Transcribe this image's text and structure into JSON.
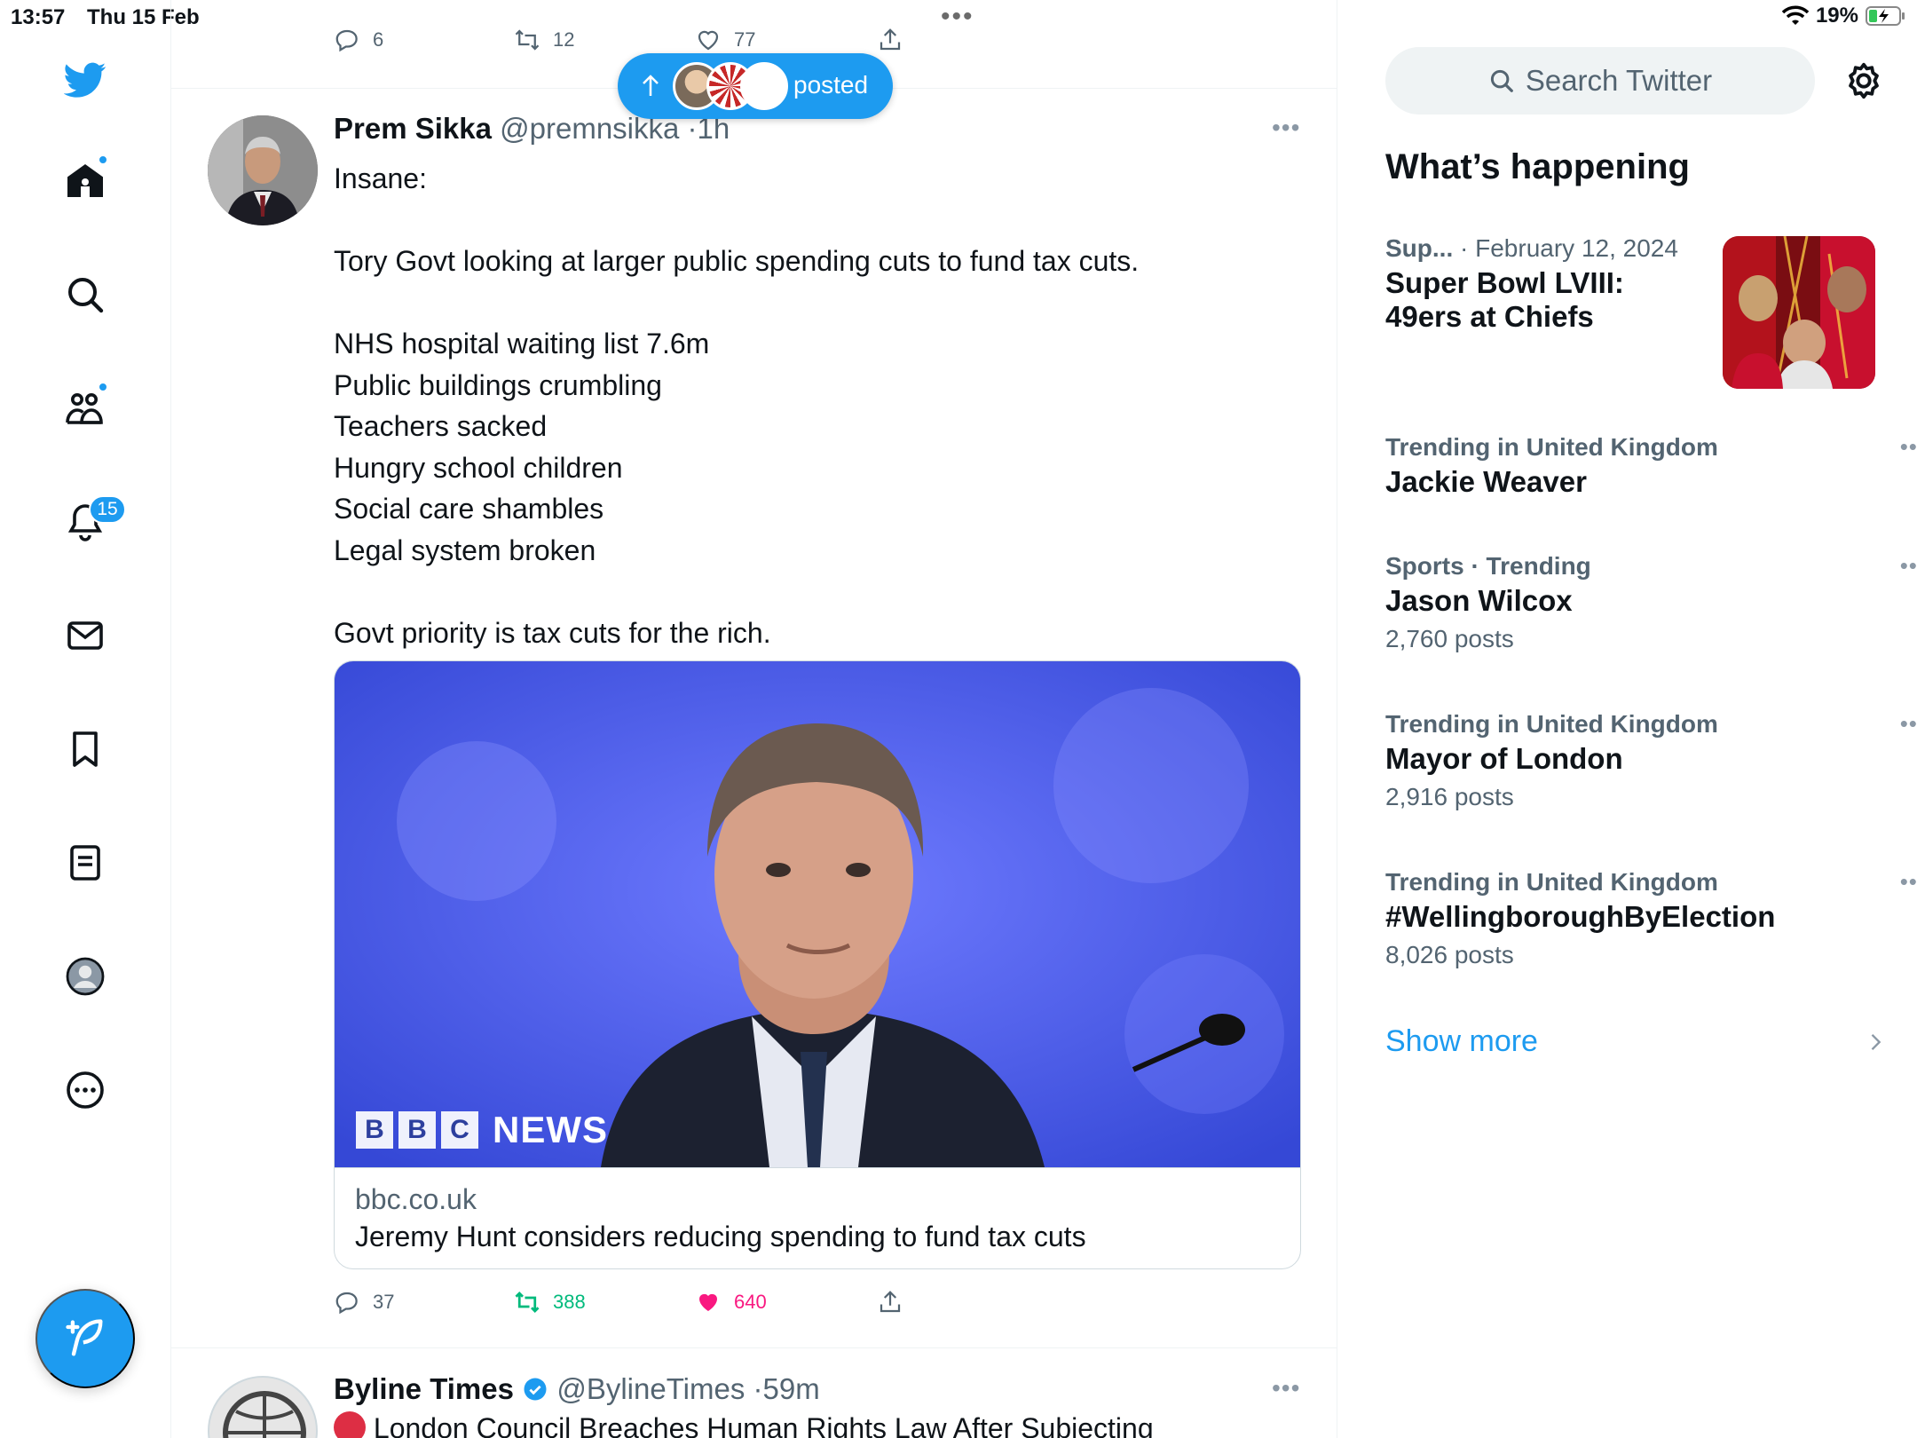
{
  "status_bar": {
    "time": "13:57",
    "date": "Thu 15 Feb",
    "battery": "19%"
  },
  "sidebar": {
    "notification_count": "15",
    "items": [
      "twitter-logo",
      "home-icon",
      "search-icon",
      "communities-icon",
      "notifications-icon",
      "messages-icon",
      "bookmarks-icon",
      "lists-icon",
      "profile-icon",
      "more-icon"
    ]
  },
  "previous_tweet": {
    "replies": "6",
    "retweets": "12",
    "likes": "77"
  },
  "new_posts_pill": {
    "label": "posted"
  },
  "tweet": {
    "name": "Prem Sikka",
    "handle": "@premnsikka",
    "time": "1h",
    "text_lines": [
      "Insane:",
      "",
      "Tory Govt looking at larger public spending cuts to fund tax cuts.",
      "",
      "NHS hospital waiting list 7.6m",
      "Public buildings crumbling",
      "Teachers sacked",
      "Hungry school children",
      "Social care shambles",
      "Legal system broken",
      "",
      "Govt priority is tax cuts for the rich."
    ],
    "card": {
      "domain": "bbc.co.uk",
      "title": "Jeremy Hunt considers reducing spending to fund tax cuts",
      "logo_letters": [
        "B",
        "B",
        "C"
      ],
      "logo_word": "NEWS"
    },
    "replies": "37",
    "retweets": "388",
    "likes": "640"
  },
  "next_tweet": {
    "name": "Byline Times",
    "handle": "@BylineTimes",
    "time": "59m",
    "text": "London Council Breaches Human Rights Law After Subjecting"
  },
  "right_column": {
    "search_placeholder": "Search Twitter",
    "section_title": "What’s happening",
    "featured": {
      "category": "Sup...",
      "date": "February 12, 2024",
      "title_line1": "Super Bowl LVIII:",
      "title_line2": "49ers at Chiefs"
    },
    "trends": [
      {
        "meta": "Trending in United Kingdom",
        "name": "Jackie Weaver",
        "count": ""
      },
      {
        "meta": "Sports · Trending",
        "name": "Jason Wilcox",
        "count": "2,760 posts"
      },
      {
        "meta": "Trending in United Kingdom",
        "name": "Mayor of London",
        "count": "2,916 posts"
      },
      {
        "meta": "Trending in United Kingdom",
        "name": "#WellingboroughByElection",
        "count": "8,026 posts"
      }
    ],
    "show_more": "Show more"
  },
  "colors": {
    "accent": "#1d9bf0",
    "retweet": "#00ba7c",
    "like": "#f91880",
    "muted": "#536471"
  }
}
